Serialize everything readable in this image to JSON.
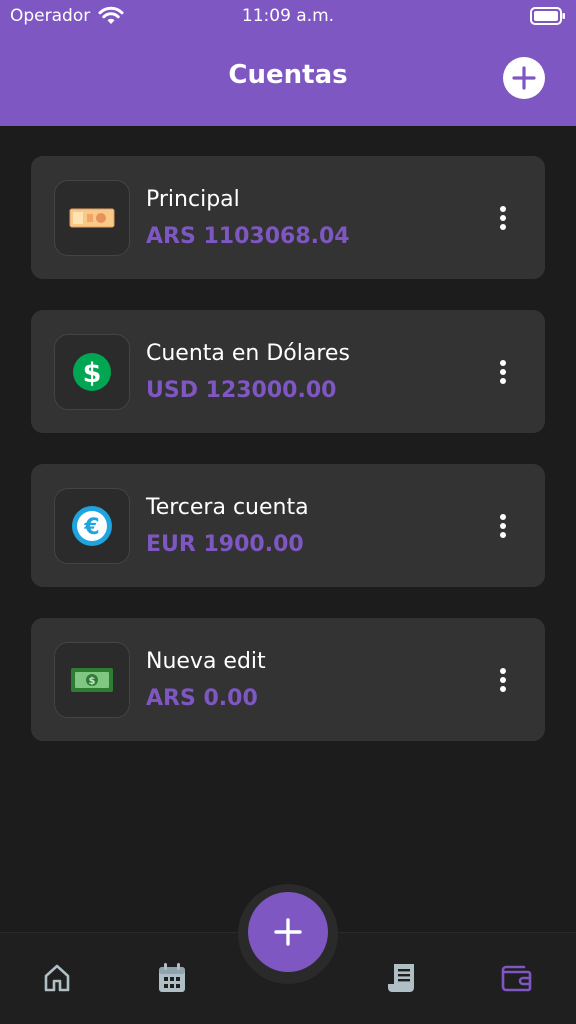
{
  "status_bar": {
    "carrier": "Operador",
    "time": "11:09 a.m."
  },
  "header": {
    "title": "Cuentas",
    "add_icon": "plus-circle-icon"
  },
  "accounts": [
    {
      "name": "Principal",
      "balance": "ARS 1103068.04",
      "icon": "banknote-icon"
    },
    {
      "name": "Cuenta en Dólares",
      "balance": "USD 123000.00",
      "icon": "dollar-coin-icon"
    },
    {
      "name": "Tercera cuenta",
      "balance": "EUR 1900.00",
      "icon": "euro-coin-icon"
    },
    {
      "name": "Nueva edit",
      "balance": "ARS 0.00",
      "icon": "money-bill-icon"
    }
  ],
  "tabs": [
    {
      "icon": "home-icon",
      "active": false
    },
    {
      "icon": "calendar-icon",
      "active": false
    },
    {
      "icon": "receipt-icon",
      "active": false
    },
    {
      "icon": "wallet-icon",
      "active": true
    }
  ],
  "colors": {
    "accent": "#7e57c2",
    "background": "#1c1c1c",
    "card": "#333333",
    "tab_inactive": "#b0bec5"
  }
}
